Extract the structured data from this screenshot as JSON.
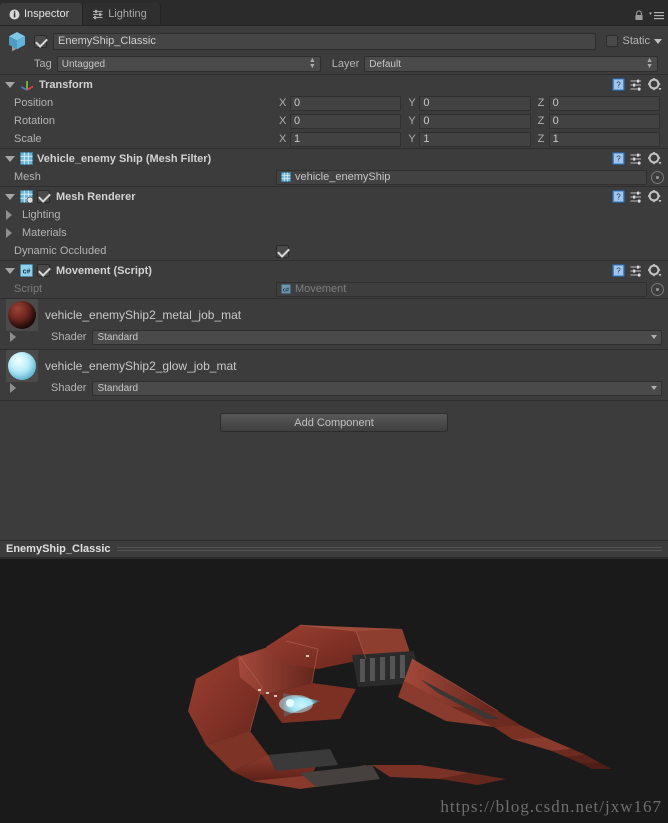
{
  "tabs": [
    {
      "label": "Inspector",
      "icon": "info-icon",
      "active": true
    },
    {
      "label": "Lighting",
      "icon": "lighting-settings-icon",
      "active": false
    }
  ],
  "tabbar": {
    "lock_icon": "lock-icon",
    "menu_icon": "hamburger-menu-icon"
  },
  "gameobject": {
    "icon": "gameobject-cube-icon",
    "enabled": true,
    "name": "EnemyShip_Classic",
    "static_label": "Static",
    "static_checked": false,
    "tag_label": "Tag",
    "tag_value": "Untagged",
    "layer_label": "Layer",
    "layer_value": "Default"
  },
  "components": [
    {
      "id": "transform",
      "title": "Transform",
      "icon": "transform-axis-icon",
      "expanded": true,
      "has_checkbox": false,
      "rows": [
        {
          "label": "Position",
          "x": "0",
          "y": "0",
          "z": "0"
        },
        {
          "label": "Rotation",
          "x": "0",
          "y": "0",
          "z": "0"
        },
        {
          "label": "Scale",
          "x": "1",
          "y": "1",
          "z": "1"
        }
      ]
    },
    {
      "id": "mesh-filter",
      "title": "Vehicle_enemy Ship (Mesh Filter)",
      "icon": "mesh-filter-icon",
      "expanded": true,
      "has_checkbox": false,
      "mesh_label": "Mesh",
      "mesh_value": "vehicle_enemyShip"
    },
    {
      "id": "mesh-renderer",
      "title": "Mesh Renderer",
      "icon": "mesh-renderer-icon",
      "expanded": true,
      "has_checkbox": true,
      "checked": true,
      "foldouts": [
        {
          "label": "Lighting"
        },
        {
          "label": "Materials"
        }
      ],
      "dynamic_occluded_label": "Dynamic Occluded",
      "dynamic_occluded_checked": true
    },
    {
      "id": "movement-script",
      "title": "Movement (Script)",
      "icon": "csharp-script-icon",
      "expanded": true,
      "has_checkbox": true,
      "checked": true,
      "script_label": "Script",
      "script_value": "Movement"
    }
  ],
  "header_icons": {
    "help": "help-book-icon",
    "preset": "preset-sliders-icon",
    "settings": "gear-dropdown-icon"
  },
  "materials": [
    {
      "name": "vehicle_enemyShip2_metal_job_mat",
      "thumb": "material-sphere-metal",
      "shader_label": "Shader",
      "shader_value": "Standard"
    },
    {
      "name": "vehicle_enemyShip2_glow_job_mat",
      "thumb": "material-sphere-glow",
      "shader_label": "Shader",
      "shader_value": "Standard"
    }
  ],
  "add_component": {
    "label": "Add Component"
  },
  "preview": {
    "title": "EnemyShip_Classic",
    "watermark": "https://blog.csdn.net/jxw167"
  }
}
